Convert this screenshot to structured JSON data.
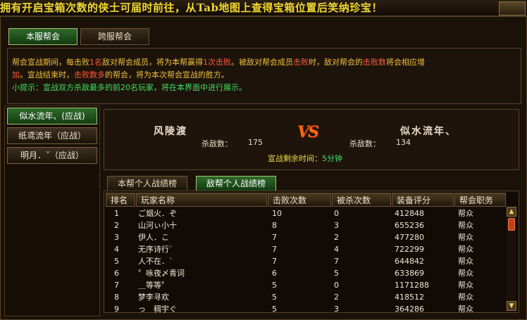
{
  "top_banner": "拥有开启宝箱次数的侠士可届时前往，从Tab地图上查得宝箱位置后笑纳珍宝！",
  "tabs": {
    "server": "本服帮会",
    "cross": "跨服帮会"
  },
  "info": {
    "line1_a": "帮会宣战期间，每击败",
    "line1_b": "1名",
    "line1_c": "敌对帮会成员，将为本帮赢得",
    "line1_d": "1次击败",
    "line1_e": "。被敌对帮会成员",
    "line1_f": "击败",
    "line1_g": "时，敌对帮会的",
    "line1_h": "击败数",
    "line1_i": "将会相应增",
    "line2_a": "加",
    "line2_b": "。宣战结束时，",
    "line2_c": "击败数多",
    "line2_d": "的帮会，将为本次帮会宣战的胜方。",
    "tip": "小提示：宣战双方杀敌最多的前20名玩家，将在本界面中进行展示。"
  },
  "guild_list": [
    {
      "label": "似水流年、(应战)"
    },
    {
      "label": "纸鸢流年（应战）"
    },
    {
      "label": "明月．ˇ（应战）"
    }
  ],
  "versus": {
    "left_name": "风陵渡",
    "right_name": "似水流年、",
    "kills_label": "杀敌数：",
    "left_kills": "175",
    "right_kills": "134",
    "vs": "VS",
    "time_label": "宣战剩余时间：",
    "time_value": "5分钟"
  },
  "subtabs": {
    "own": "本帮个人战绩榜",
    "enemy": "敌帮个人战绩榜"
  },
  "table": {
    "headers": [
      "排名",
      "玩家名称",
      "击败次数",
      "被杀次数",
      "装备评分",
      "帮会职务"
    ],
    "rows": [
      [
        "1",
        "ご烟火．ぞ",
        "10",
        "0",
        "412848",
        "帮众"
      ],
      [
        "2",
        "山河ぃ小十",
        "8",
        "3",
        "655236",
        "帮众"
      ],
      [
        "3",
        "伊人．こ",
        "7",
        "2",
        "477280",
        "帮众"
      ],
      [
        "4",
        "无序诗行ˋ",
        "7",
        "4",
        "722299",
        "帮众"
      ],
      [
        "5",
        "人不在．ˋ",
        "7",
        "7",
        "644842",
        "帮众"
      ],
      [
        "6",
        "〞咏夜〆青词",
        "6",
        "5",
        "633869",
        "帮众"
      ],
      [
        "7",
        "＿等等〞",
        "5",
        "0",
        "1171288",
        "帮众"
      ],
      [
        "8",
        "梦李寻欢",
        "5",
        "2",
        "418512",
        "帮众"
      ],
      [
        "9",
        "っ　稠宇ぐ",
        "5",
        "3",
        "364286",
        "帮众"
      ]
    ]
  },
  "colors": {
    "accent_green": "#40e060",
    "accent_yellow": "#f0c040",
    "accent_red": "#ff5a3c",
    "vs_orange": "#ff6a10"
  }
}
